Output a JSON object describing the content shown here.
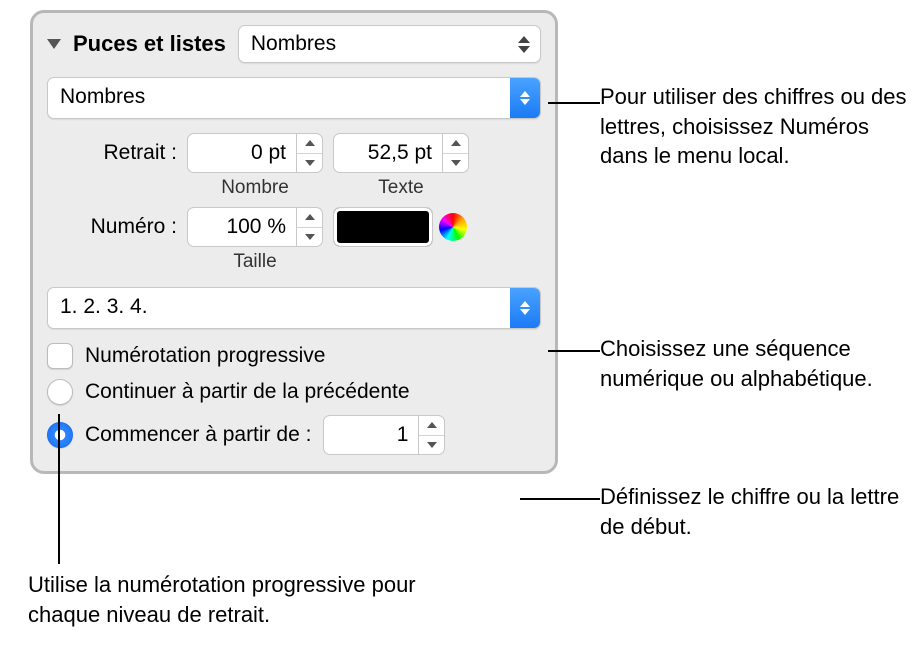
{
  "header": {
    "title": "Puces et listes",
    "type_menu": "Nombres"
  },
  "list_type": "Nombres",
  "indent": {
    "label": "Retrait :",
    "number_value": "0 pt",
    "number_sub": "Nombre",
    "text_value": "52,5 pt",
    "text_sub": "Texte"
  },
  "number": {
    "label": "Numéro :",
    "size_value": "100 %",
    "size_sub": "Taille"
  },
  "sequence": "1. 2. 3. 4.",
  "progressive": {
    "label": "Numérotation progressive",
    "checked": false
  },
  "options": {
    "continue": "Continuer à partir de la précédente",
    "start": "Commencer à partir de :",
    "start_value": "1",
    "selected": "start"
  },
  "callouts": {
    "c1": "Pour utiliser des chiffres ou des lettres, choisissez Numéros dans le menu local.",
    "c2": "Choisissez une séquence numérique ou alphabétique.",
    "c3": "Définissez le chiffre ou la lettre de début.",
    "c4": "Utilise la numérotation progressive pour chaque niveau de retrait."
  }
}
